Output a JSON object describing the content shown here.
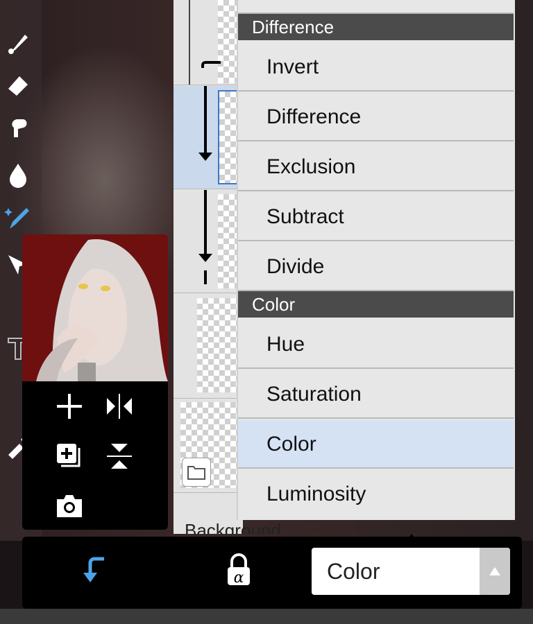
{
  "blend_menu": {
    "sections": [
      {
        "header": "Difference",
        "items": [
          "Invert",
          "Difference",
          "Exclusion",
          "Subtract",
          "Divide"
        ]
      },
      {
        "header": "Color",
        "items": [
          "Hue",
          "Saturation",
          "Color",
          "Luminosity"
        ]
      }
    ],
    "selected": "Color"
  },
  "layer_panel": {
    "bottom_label": "Background"
  },
  "bottom_bar": {
    "blend_mode_value": "Color"
  },
  "colors": {
    "menu_header": "#4b4b4b",
    "menu_bg": "#e7e7e7",
    "selected_bg": "#d4e2f4",
    "accent_blue": "#4ea3e8"
  },
  "icons": {
    "left_toolbar": [
      "brush-icon",
      "eraser-icon",
      "smudge-icon",
      "blur-drop-icon",
      "magic-pen-icon",
      "selection-icon",
      "text-icon",
      "dropper-icon"
    ],
    "reference_controls": [
      "plus-icon",
      "flip-horizontal-icon",
      "add-layer-icon",
      "flip-vertical-icon",
      "camera-icon"
    ],
    "bottom_bar": [
      "clip-arrow-icon",
      "alpha-lock-icon",
      "dropdown-arrow-icon"
    ]
  }
}
